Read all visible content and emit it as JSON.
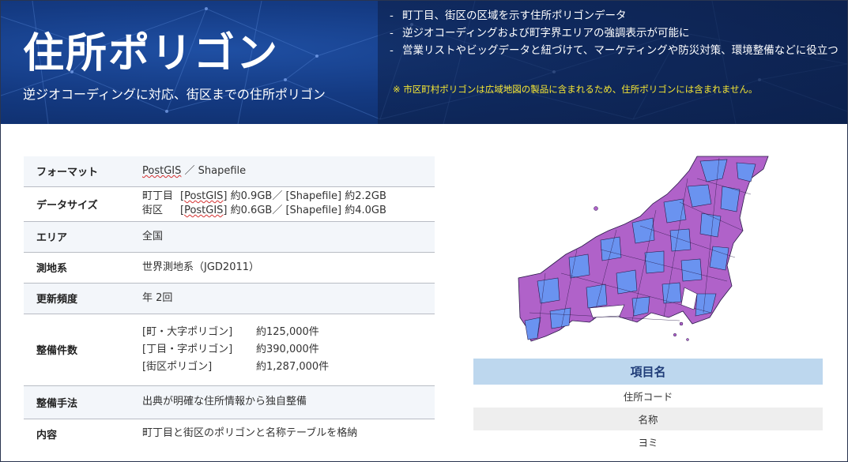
{
  "banner": {
    "title": "住所ポリゴン",
    "subtitle": "逆ジオコーディングに対応、街区までの住所ポリゴン",
    "bullets": [
      "町丁目、街区の区域を示す住所ポリゴンデータ",
      "逆ジオコーディングおよび町字界エリアの強調表示が可能に",
      "営業リストやビッグデータと紐づけて、マーケティングや防災対策、環境整備などに役立つ"
    ],
    "note": "※ 市区町村ポリゴンは広域地図の製品に含まれるため、住所ポリゴンには含まれません。"
  },
  "spec": {
    "format": {
      "label": "フォーマット",
      "postgis": "PostGIS",
      "rest": " ／ Shapefile"
    },
    "datasize": {
      "label": "データサイズ",
      "line1_name": "町丁目",
      "line1_tag": "[PostGIS]",
      "line1_rest": " 約0.9GB／ [Shapefile] 約2.2GB",
      "line2_name": "街区",
      "line2_tag": "[PostGIS]",
      "line2_rest": " 約0.6GB／ [Shapefile] 約4.0GB"
    },
    "area": {
      "label": "エリア",
      "value": "全国"
    },
    "crs": {
      "label": "測地系",
      "value": "世界測地系（JGD2011）"
    },
    "update": {
      "label": "更新頻度",
      "value": "年 2回"
    },
    "count": {
      "label": "整備件数",
      "rows": [
        {
          "type": "[町・大字ポリゴン]",
          "count": "約125,000件"
        },
        {
          "type": "[丁目・字ポリゴン]",
          "count": "約390,000件"
        },
        {
          "type": "[街区ポリゴン]",
          "count": "約1,287,000件"
        }
      ]
    },
    "method": {
      "label": "整備手法",
      "value": "出典が明確な住所情報から独自整備"
    },
    "content": {
      "label": "内容",
      "value": "町丁目と街区のポリゴンと名称テーブルを格納"
    }
  },
  "items": {
    "header": "項目名",
    "rows": [
      "住所コード",
      "名称",
      "ヨミ"
    ]
  },
  "colors": {
    "banner_blue": "#143a82",
    "note_yellow": "#f6e733",
    "map_purple": "#b062c9",
    "map_blue": "#6a93f0",
    "item_header_bg": "#bdd7ee"
  }
}
